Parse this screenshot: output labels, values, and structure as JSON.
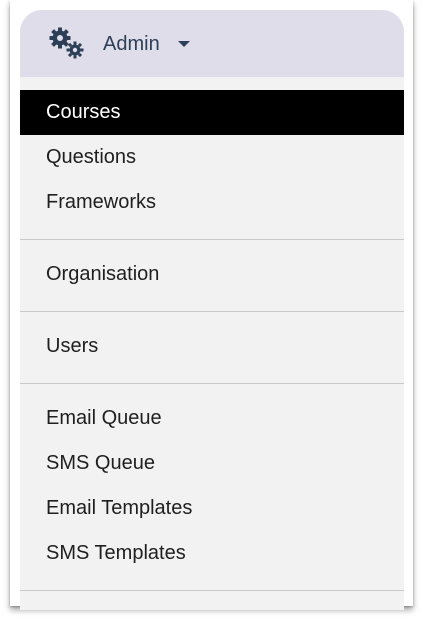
{
  "header": {
    "icon": "gears-icon",
    "label": "Admin",
    "caret_icon": "caret-down-icon"
  },
  "colors": {
    "header_background": "#dedde9",
    "menu_background": "#f2f2f2",
    "active_background": "#000000",
    "active_text": "#ffffff",
    "text": "#1f1f1f",
    "header_text": "#2d3e57"
  },
  "menu": {
    "items": [
      {
        "label": "Courses",
        "active": true
      },
      {
        "label": "Questions",
        "active": false
      },
      {
        "label": "Frameworks",
        "active": false
      },
      {
        "label": "Organisation",
        "active": false
      },
      {
        "label": "Users",
        "active": false
      },
      {
        "label": "Email Queue",
        "active": false
      },
      {
        "label": "SMS Queue",
        "active": false
      },
      {
        "label": "Email Templates",
        "active": false
      },
      {
        "label": "SMS Templates",
        "active": false
      }
    ]
  }
}
